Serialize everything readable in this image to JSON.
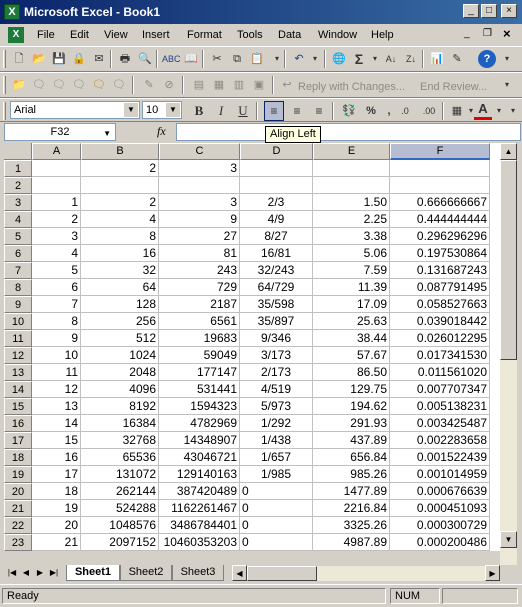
{
  "window": {
    "title": "Microsoft Excel - Book1",
    "app_icon_glyph": "X"
  },
  "menu": {
    "items": [
      "File",
      "Edit",
      "View",
      "Insert",
      "Format",
      "Tools",
      "Data",
      "Window",
      "Help"
    ],
    "doc_close": "×"
  },
  "toolbar_review": {
    "reply_label": "Reply with Changes...",
    "end_label": "End Review..."
  },
  "font_bar": {
    "font_name": "Arial",
    "font_size": "10",
    "bold": "B",
    "italic": "I",
    "underline": "U",
    "percent": "%",
    "comma": ",",
    "inc_dec": ".0",
    "dec_dec": ".00",
    "font_color_glyph": "A"
  },
  "formula_bar": {
    "name_box": "F32",
    "fx": "fx",
    "formula": ""
  },
  "tooltip": "Align Left",
  "sheet": {
    "columns": [
      "A",
      "B",
      "C",
      "D",
      "E",
      "F"
    ],
    "selected_column": "F",
    "rows": [
      {
        "n": "1",
        "cells": [
          "",
          "2",
          "3",
          "",
          "",
          ""
        ]
      },
      {
        "n": "2",
        "cells": [
          "",
          "",
          "",
          "",
          "",
          ""
        ]
      },
      {
        "n": "3",
        "cells": [
          "1",
          "2",
          "3",
          "2/3",
          "1.50",
          "0.666666667"
        ]
      },
      {
        "n": "4",
        "cells": [
          "2",
          "4",
          "9",
          "4/9",
          "2.25",
          "0.444444444"
        ]
      },
      {
        "n": "5",
        "cells": [
          "3",
          "8",
          "27",
          "8/27",
          "3.38",
          "0.296296296"
        ]
      },
      {
        "n": "6",
        "cells": [
          "4",
          "16",
          "81",
          "16/81",
          "5.06",
          "0.197530864"
        ]
      },
      {
        "n": "7",
        "cells": [
          "5",
          "32",
          "243",
          "32/243",
          "7.59",
          "0.131687243"
        ]
      },
      {
        "n": "8",
        "cells": [
          "6",
          "64",
          "729",
          "64/729",
          "11.39",
          "0.087791495"
        ]
      },
      {
        "n": "9",
        "cells": [
          "7",
          "128",
          "2187",
          "35/598",
          "17.09",
          "0.058527663"
        ]
      },
      {
        "n": "10",
        "cells": [
          "8",
          "256",
          "6561",
          "35/897",
          "25.63",
          "0.039018442"
        ]
      },
      {
        "n": "11",
        "cells": [
          "9",
          "512",
          "19683",
          "9/346",
          "38.44",
          "0.026012295"
        ]
      },
      {
        "n": "12",
        "cells": [
          "10",
          "1024",
          "59049",
          "3/173",
          "57.67",
          "0.017341530"
        ]
      },
      {
        "n": "13",
        "cells": [
          "11",
          "2048",
          "177147",
          "2/173",
          "86.50",
          "0.011561020"
        ]
      },
      {
        "n": "14",
        "cells": [
          "12",
          "4096",
          "531441",
          "4/519",
          "129.75",
          "0.007707347"
        ]
      },
      {
        "n": "15",
        "cells": [
          "13",
          "8192",
          "1594323",
          "5/973",
          "194.62",
          "0.005138231"
        ]
      },
      {
        "n": "16",
        "cells": [
          "14",
          "16384",
          "4782969",
          "1/292",
          "291.93",
          "0.003425487"
        ]
      },
      {
        "n": "17",
        "cells": [
          "15",
          "32768",
          "14348907",
          "1/438",
          "437.89",
          "0.002283658"
        ]
      },
      {
        "n": "18",
        "cells": [
          "16",
          "65536",
          "43046721",
          "1/657",
          "656.84",
          "0.001522439"
        ]
      },
      {
        "n": "19",
        "cells": [
          "17",
          "131072",
          "129140163",
          "1/985",
          "985.26",
          "0.001014959"
        ]
      },
      {
        "n": "20",
        "cells": [
          "18",
          "262144",
          "387420489",
          "0",
          "1477.89",
          "0.000676639"
        ]
      },
      {
        "n": "21",
        "cells": [
          "19",
          "524288",
          "1162261467",
          "0",
          "2216.84",
          "0.000451093"
        ]
      },
      {
        "n": "22",
        "cells": [
          "20",
          "1048576",
          "3486784401",
          "0",
          "3325.26",
          "0.000300729"
        ]
      },
      {
        "n": "23",
        "cells": [
          "21",
          "2097152",
          "10460353203",
          "0",
          "4987.89",
          "0.000200486"
        ]
      }
    ]
  },
  "tabs": {
    "sheets": [
      "Sheet1",
      "Sheet2",
      "Sheet3"
    ],
    "active": "Sheet1"
  },
  "status": {
    "left": "Ready",
    "num": "NUM"
  },
  "colors": {
    "title_start": "#0a246a",
    "title_end": "#3a6ea5",
    "selected_header": "#b6bdd2",
    "tooltip_bg": "#ffffe1"
  }
}
